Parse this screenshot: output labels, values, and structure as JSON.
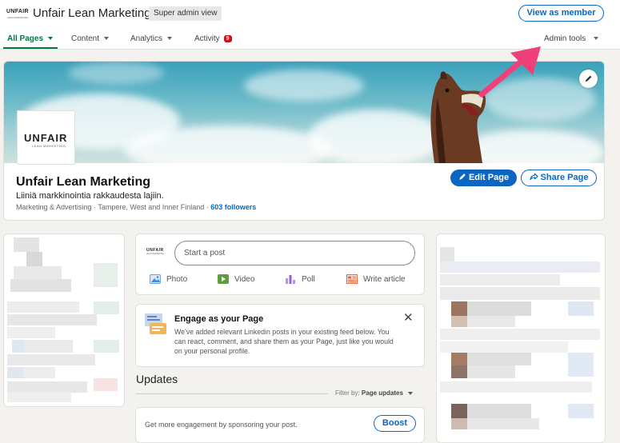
{
  "header": {
    "logo_text": "UNFAIR",
    "logo_sub": "LEAN MARKETING",
    "title": "Unfair Lean Marketing",
    "admin_badge": "Super admin view",
    "view_as_member": "View as member"
  },
  "nav": {
    "all_pages": "All Pages",
    "content": "Content",
    "analytics": "Analytics",
    "activity": "Activity",
    "activity_count": "9",
    "admin_tools": "Admin tools"
  },
  "profile": {
    "logo_text": "UNFAIR",
    "logo_sub": "LEAN MARKETING",
    "name": "Unfair Lean Marketing",
    "tagline": "Liiniä markkinointia rakkaudesta lajiin.",
    "meta": "Marketing & Advertising · Tampere, West and Inner Finland · ",
    "followers": "603 followers",
    "edit_page": "Edit Page",
    "share_page": "Share Page"
  },
  "composer": {
    "logo_text": "UNFAIR",
    "logo_sub": "LEAN MARKETING",
    "placeholder": "Start a post",
    "photo": "Photo",
    "video": "Video",
    "poll": "Poll",
    "write_article": "Write article"
  },
  "engage": {
    "title": "Engage as your Page",
    "body": "We've added relevant Linkedin posts in your existing feed below. You can react, comment, and share them as your Page, just like you would on your personal profile."
  },
  "updates": {
    "title": "Updates",
    "filter_label": "Filter by:",
    "filter_value": "Page updates",
    "sponsor_text": "Get more engagement by sponsoring your post.",
    "boost": "Boost"
  },
  "colors": {
    "linkedin_blue": "#0a66c2",
    "active_green": "#057642",
    "annotation_arrow": "#f0407a",
    "badge_red": "#cc1016"
  }
}
